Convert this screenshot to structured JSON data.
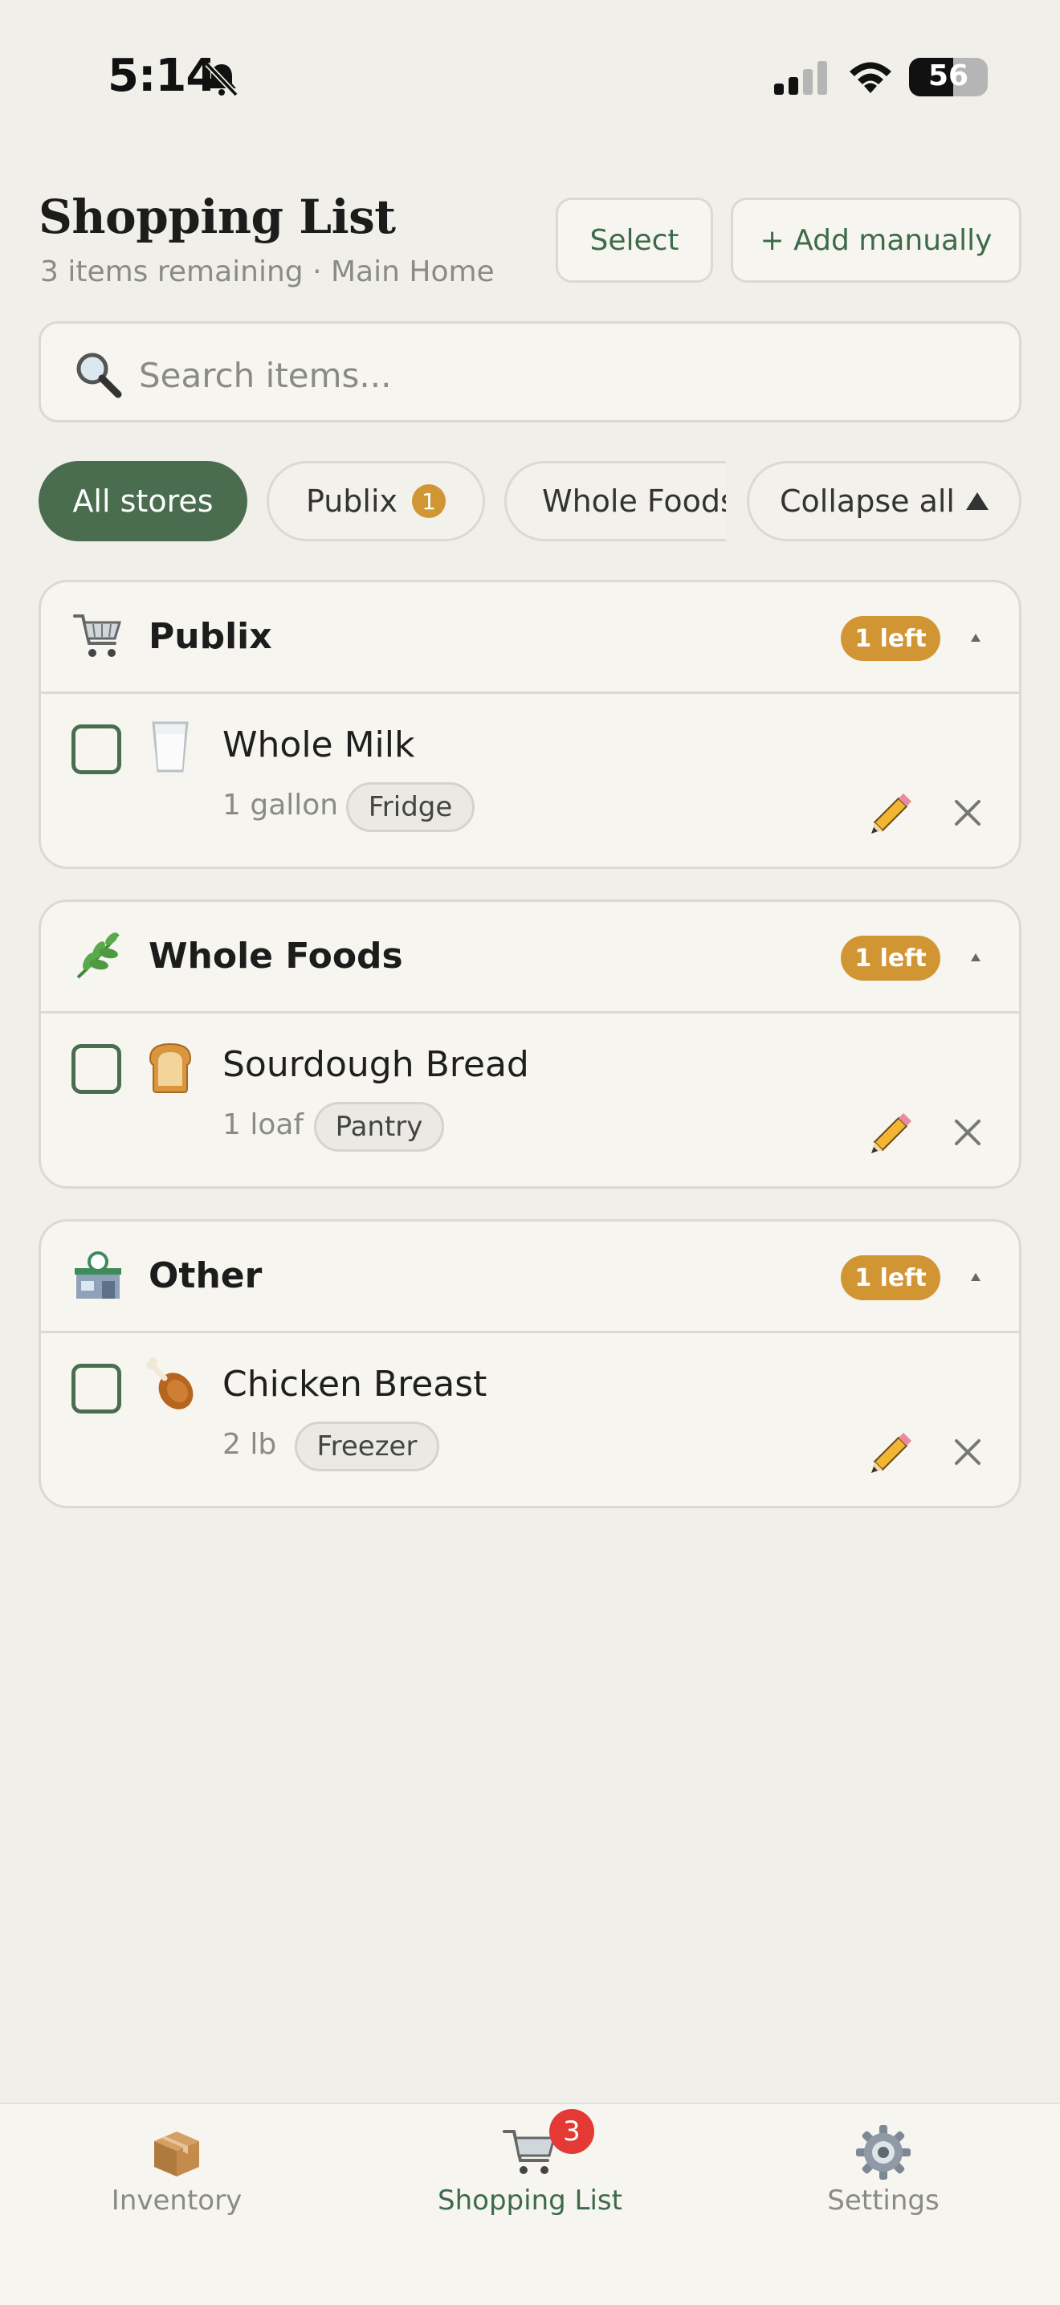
{
  "status_bar": {
    "time": "5:14",
    "battery": "56"
  },
  "header": {
    "title": "Shopping List",
    "subtitle": "3 items remaining · Main Home",
    "select_label": "Select",
    "add_label": "+ Add manually"
  },
  "search": {
    "placeholder": "Search items..."
  },
  "filters": {
    "all_label": "All stores",
    "publix_label": "Publix",
    "publix_count": "1",
    "whole_foods_label": "Whole Foods",
    "collapse_label": "Collapse all"
  },
  "stores": [
    {
      "name": "Publix",
      "left": "1 left",
      "icon": "shopping-cart-icon",
      "item": {
        "name": "Whole Milk",
        "qty": "1 gallon",
        "location": "Fridge",
        "icon": "milk-glass-icon"
      }
    },
    {
      "name": "Whole Foods",
      "left": "1 left",
      "icon": "herb-icon",
      "item": {
        "name": "Sourdough Bread",
        "qty": "1 loaf",
        "location": "Pantry",
        "icon": "bread-icon"
      }
    },
    {
      "name": "Other",
      "left": "1 left",
      "icon": "convenience-store-icon",
      "item": {
        "name": "Chicken Breast",
        "qty": "2 lb",
        "location": "Freezer",
        "icon": "poultry-leg-icon"
      }
    }
  ],
  "tabs": [
    {
      "label": "Inventory",
      "icon": "package-icon"
    },
    {
      "label": "Shopping List",
      "icon": "shopping-cart-icon",
      "badge": "3",
      "active": true
    },
    {
      "label": "Settings",
      "icon": "gear-icon"
    }
  ],
  "colors": {
    "accent": "#4a6d50",
    "badge": "#d19534",
    "tab_badge": "#e53935",
    "background": "#f1efea"
  }
}
